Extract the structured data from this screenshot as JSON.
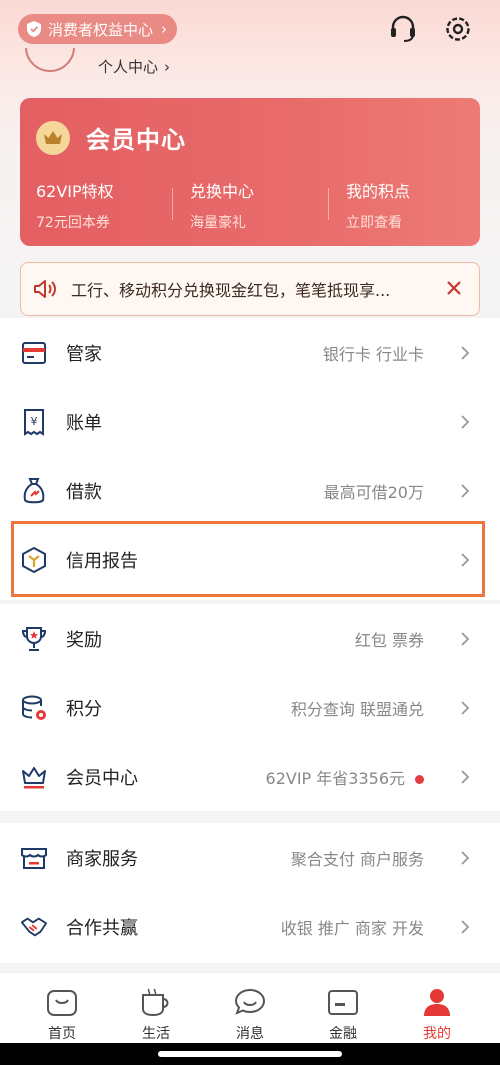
{
  "header": {
    "consumer_rights_label": "消费者权益中心",
    "profile_link_label": "个人中心"
  },
  "vip_card": {
    "title": "会员中心",
    "columns": [
      {
        "title": "62VIP特权",
        "subtitle": "72元回本券"
      },
      {
        "title": "兑换中心",
        "subtitle": "海量豪礼"
      },
      {
        "title": "我的积点",
        "subtitle": "立即查看"
      }
    ]
  },
  "notice": {
    "text": "工行、移动积分兑换现金红包，笔笔抵现享..."
  },
  "menu_group_1": [
    {
      "label": "管家",
      "right": "银行卡 行业卡",
      "icon": "card-manager-icon"
    },
    {
      "label": "账单",
      "right": "",
      "icon": "bill-icon"
    },
    {
      "label": "借款",
      "right": "最高可借20万",
      "icon": "money-bag-icon"
    },
    {
      "label": "信用报告",
      "right": "",
      "icon": "credit-report-icon"
    }
  ],
  "menu_group_2": [
    {
      "label": "奖励",
      "right": "红包 票券",
      "icon": "trophy-icon"
    },
    {
      "label": "积分",
      "right": "积分查询 联盟通兑",
      "icon": "points-icon"
    },
    {
      "label": "会员中心",
      "right": "62VIP 年省3356元",
      "icon": "crown-icon"
    }
  ],
  "menu_group_3": [
    {
      "label": "商家服务",
      "right": "聚合支付 商户服务",
      "icon": "store-icon"
    },
    {
      "label": "合作共赢",
      "right": "收银 推广 商家 开发",
      "icon": "handshake-icon"
    }
  ],
  "tabbar": {
    "tabs": [
      {
        "label": "首页",
        "icon": "home-icon"
      },
      {
        "label": "生活",
        "icon": "life-cup-icon"
      },
      {
        "label": "消息",
        "icon": "message-icon"
      },
      {
        "label": "金融",
        "icon": "finance-icon"
      },
      {
        "label": "我的",
        "icon": "profile-icon",
        "active": true
      }
    ]
  },
  "colors": {
    "accent_red": "#e53935",
    "vip_card": "#e45f62",
    "highlight_orange": "#f0743e"
  }
}
